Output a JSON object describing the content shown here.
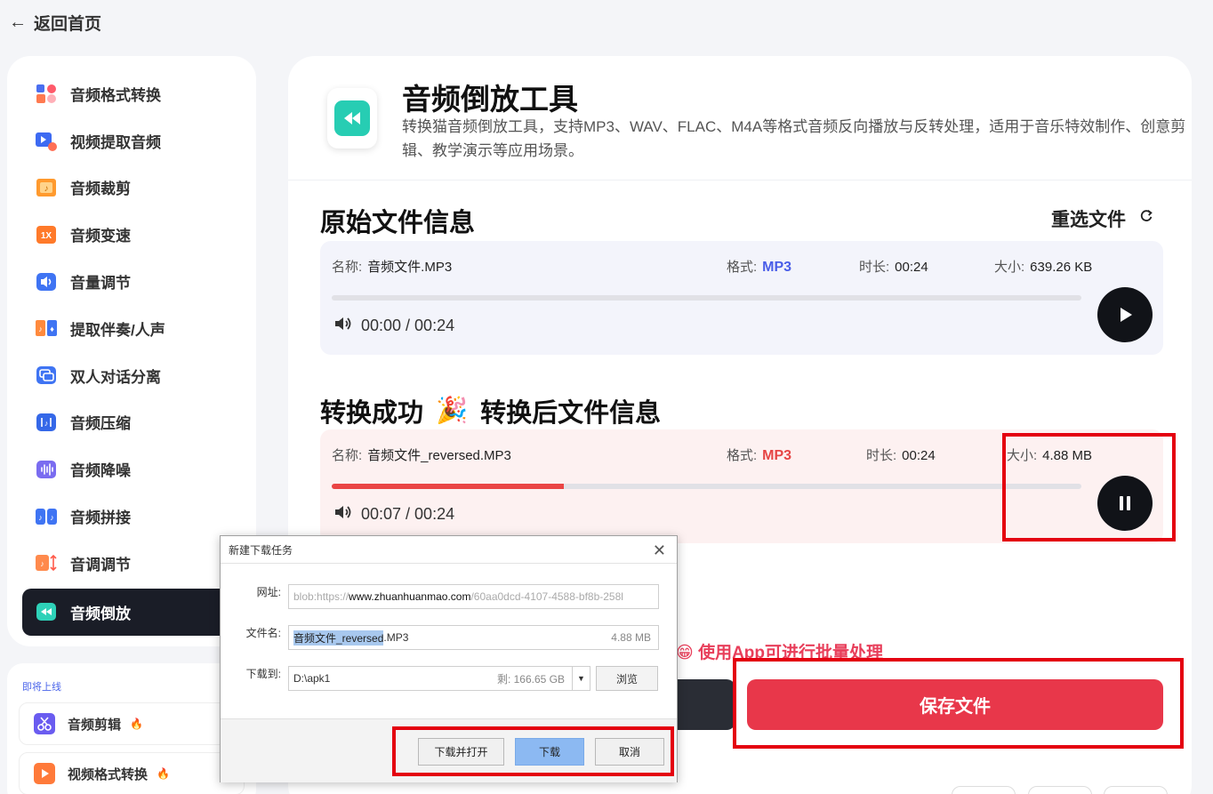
{
  "nav": {
    "back_label": "返回首页"
  },
  "sidebar": {
    "items": [
      {
        "label": "音频格式转换",
        "icon": "audio-format-icon"
      },
      {
        "label": "视频提取音频",
        "icon": "video-extract-icon"
      },
      {
        "label": "音频裁剪",
        "icon": "audio-cut-icon"
      },
      {
        "label": "音频变速",
        "icon": "speed-icon"
      },
      {
        "label": "音量调节",
        "icon": "volume-adjust-icon"
      },
      {
        "label": "提取伴奏/人声",
        "icon": "vocal-extract-icon"
      },
      {
        "label": "双人对话分离",
        "icon": "dialog-separate-icon"
      },
      {
        "label": "音频压缩",
        "icon": "compress-icon"
      },
      {
        "label": "音频降噪",
        "icon": "denoise-icon"
      },
      {
        "label": "音频拼接",
        "icon": "merge-icon"
      },
      {
        "label": "音调调节",
        "icon": "pitch-icon"
      },
      {
        "label": "音频倒放",
        "icon": "reverse-icon",
        "active": true
      }
    ],
    "speed_badge": "1X"
  },
  "upcoming": {
    "heading": "即将上线",
    "items": [
      {
        "label": "音频剪辑",
        "icon": "scissors-icon"
      },
      {
        "label": "视频格式转换",
        "icon": "video-format-icon"
      }
    ]
  },
  "tool": {
    "title": "音频倒放工具",
    "description": "转换猫音频倒放工具，支持MP3、WAV、FLAC、M4A等格式音频反向播放与反转处理，适用于音乐特效制作、创意剪辑、教学演示等应用场景。"
  },
  "original": {
    "section_title": "原始文件信息",
    "reselect_label": "重选文件",
    "name_label": "名称:",
    "name": "音频文件.MP3",
    "format_label": "格式:",
    "format": "MP3",
    "duration_label": "时长:",
    "duration": "00:24",
    "size_label": "大小:",
    "size": "639.26 KB",
    "time_display": "00:00 / 00:24",
    "progress": 0
  },
  "converted": {
    "section_title_a": "转换成功",
    "section_title_b": "转换后文件信息",
    "name_label": "名称:",
    "name": "音频文件_reversed.MP3",
    "format_label": "格式:",
    "format": "MP3",
    "duration_label": "时长:",
    "duration": "00:24",
    "size_label": "大小:",
    "size": "4.88 MB",
    "time_display": "00:07 / 00:24",
    "progress": 0.31
  },
  "actions": {
    "promo": "😁 使用App可进行批量处理",
    "save_label": "保存文件"
  },
  "dialog": {
    "title": "新建下载任务",
    "url_label": "网址:",
    "url_prefix": "blob:https://",
    "url_domain": "www.zhuanhuanmao.com",
    "url_suffix": "/60aa0dcd-4107-4588-bf8b-258l",
    "filename_label": "文件名:",
    "filename_selected": "音频文件_reversed",
    "filename_ext": ".MP3",
    "filename_size": "4.88 MB",
    "saveto_label": "下载到:",
    "saveto_path": "D:\\apk1",
    "saveto_free": "剩: 166.65 GB",
    "browse_label": "浏览",
    "btn_download_open": "下载并打开",
    "btn_download": "下载",
    "btn_cancel": "取消"
  }
}
